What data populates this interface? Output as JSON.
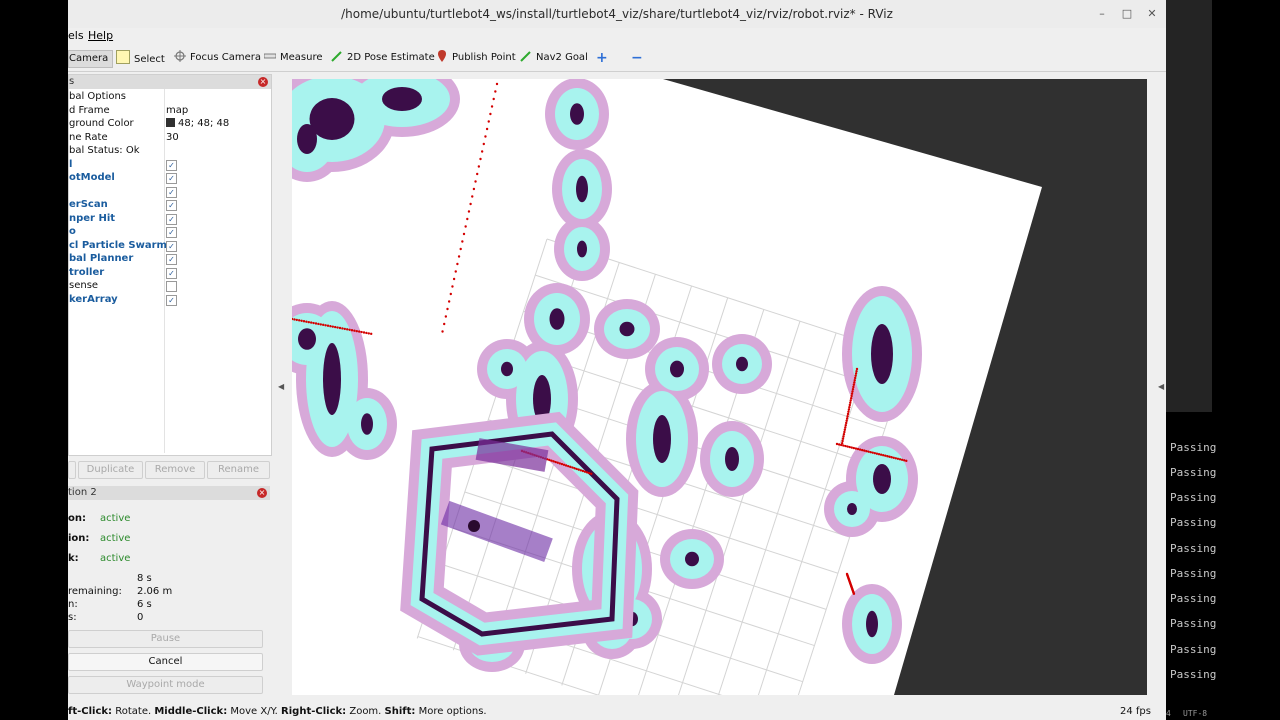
{
  "window": {
    "title": "/home/ubuntu/turtlebot4_ws/install/turtlebot4_viz/share/turtlebot4_viz/rviz/robot.rviz* - RViz",
    "minimize": "–",
    "maximize": "□",
    "close": "✕"
  },
  "menu": {
    "panels": "els",
    "help": "Help"
  },
  "toolbar": {
    "move_camera": "Camera",
    "select": "Select",
    "focus_camera": "Focus Camera",
    "measure": "Measure",
    "pose_estimate": "2D Pose Estimate",
    "publish_point": "Publish Point",
    "nav2_goal": "Nav2 Goal",
    "add": "+",
    "remove": "−"
  },
  "displays": {
    "header": "s",
    "rows": [
      {
        "label": "bal Options",
        "value": ""
      },
      {
        "label": "d Frame",
        "value": "map"
      },
      {
        "label": "ground Color",
        "value": "48; 48; 48"
      },
      {
        "label": "ne Rate",
        "value": "30"
      },
      {
        "label": "bal Status: Ok",
        "value": ""
      }
    ],
    "items": [
      {
        "label": "l",
        "checked": "✓"
      },
      {
        "label": "otModel",
        "checked": "✓"
      },
      {
        "label": "",
        "checked": "✓"
      },
      {
        "label": "erScan",
        "checked": "✓"
      },
      {
        "label": "nper Hit",
        "checked": "✓"
      },
      {
        "label": "o",
        "checked": "✓"
      },
      {
        "label": "cl Particle Swarm",
        "checked": "✓"
      },
      {
        "label": "bal Planner",
        "checked": "✓"
      },
      {
        "label": "troller",
        "checked": "✓"
      },
      {
        "label": "sense",
        "checked": ""
      },
      {
        "label": "kerArray",
        "checked": "✓"
      }
    ],
    "buttons": {
      "duplicate": "Duplicate",
      "remove": "Remove",
      "rename": "Rename"
    }
  },
  "nav_panel": {
    "header": "tion 2",
    "status": [
      {
        "label": "on:",
        "value": "active"
      },
      {
        "label": "ion:",
        "value": "active"
      },
      {
        "label": "k:",
        "value": "active"
      }
    ],
    "metrics": [
      {
        "label": "",
        "value": "8 s"
      },
      {
        "label": "remaining:",
        "value": "2.06 m"
      },
      {
        "label": "n:",
        "value": "6 s"
      },
      {
        "label": "s:",
        "value": "0"
      }
    ],
    "pause": "Pause",
    "cancel": "Cancel",
    "waypoint": "Waypoint mode"
  },
  "statusbar": {
    "hint_a": "ft-Click:",
    "hint_a_text": "Rotate.",
    "hint_b": "Middle-Click:",
    "hint_b_text": "Move X/Y.",
    "hint_c": "Right-Click:",
    "hint_c_text": "Zoom.",
    "hint_d": "Shift:",
    "hint_d_text": "More options.",
    "fps": "24 fps"
  },
  "terminal": {
    "lines": [
      "Passing",
      "Passing",
      "Passing",
      "Passing",
      "Passing",
      "Passing",
      "Passing",
      "Passing",
      "Passing",
      "Passing"
    ],
    "footer_left": "4",
    "footer_right": "UTF-8"
  },
  "colors": {
    "viewport_background": "#303030",
    "map_free": "#ffffff",
    "costmap_inflation": "#d7a9d9",
    "costmap_inscribed": "#a8f3ee",
    "obstacle": "#3b0d48",
    "laser": "#d40000"
  }
}
